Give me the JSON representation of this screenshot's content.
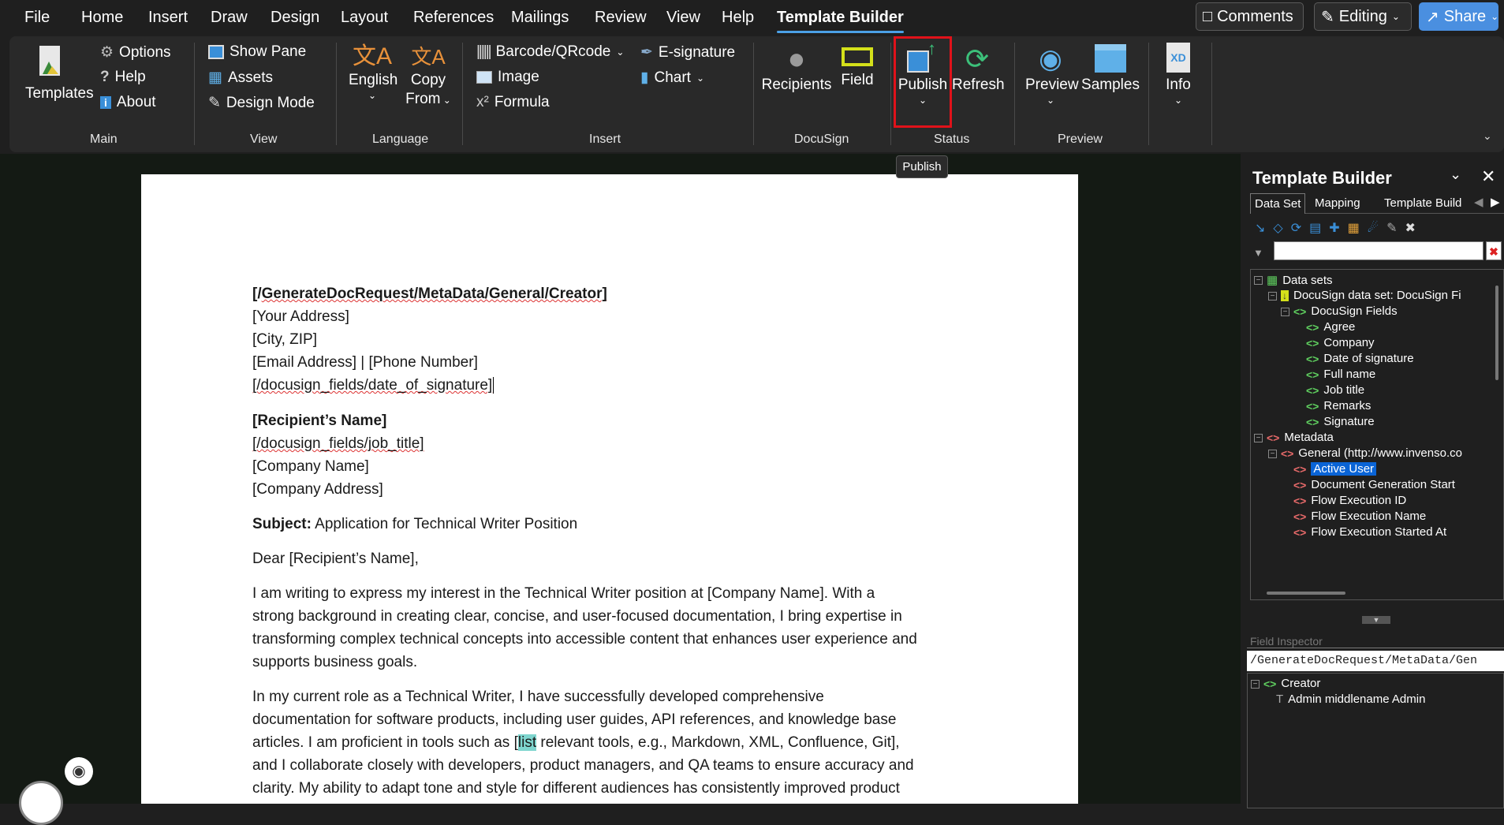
{
  "menu": {
    "tabs": [
      "File",
      "Home",
      "Insert",
      "Draw",
      "Design",
      "Layout",
      "References",
      "Mailings",
      "Review",
      "View",
      "Help",
      "Template Builder"
    ],
    "active": "Template Builder",
    "comments": "Comments",
    "editing": "Editing",
    "share": "Share"
  },
  "ribbon": {
    "main": {
      "templates": "Templates",
      "options": "Options",
      "help": "Help",
      "about": "About",
      "label": "Main"
    },
    "view": {
      "show_pane": "Show Pane",
      "assets": "Assets",
      "design_mode": "Design Mode",
      "label": "View"
    },
    "language": {
      "english": "English",
      "copy": "Copy",
      "from": "From",
      "label": "Language"
    },
    "insert": {
      "barcode": "Barcode/QRcode",
      "image": "Image",
      "formula": "Formula",
      "esign": "E-signature",
      "chart": "Chart",
      "label": "Insert"
    },
    "docusign": {
      "recipients": "Recipients",
      "field": "Field",
      "label": "DocuSign"
    },
    "status": {
      "publish": "Publish",
      "refresh": "Refresh",
      "label": "Status"
    },
    "preview": {
      "preview": "Preview",
      "samples": "Samples",
      "label": "Preview"
    },
    "info": {
      "info": "Info"
    },
    "tooltip": "Publish"
  },
  "doc": {
    "creator": "[/GenerateDocRequest/MetaData/General/Creator]",
    "address": "[Your Address]",
    "city": "[City, ZIP]",
    "email": "[Email Address] | [Phone Number]",
    "date_field": "[/docusign_fields/date_of_signature]",
    "recipient": "[Recipient’s Name]",
    "job_field": "[/docusign_fields/job_title]",
    "company": "[Company Name]",
    "company_addr": "[Company Address]",
    "subject_label": "Subject:",
    "subject": " Application for Technical Writer Position",
    "dear": "Dear [Recipient’s Name],",
    "p1": [
      "I am writing to express my interest in the Technical Writer position at [Company Name]. With a",
      "strong background in creating clear, concise, and user-focused documentation, I bring expertise in",
      "transforming complex technical concepts into accessible content that enhances user experience and",
      "supports business goals."
    ],
    "p2a": "In my current role as a Technical Writer, I have successfully developed comprehensive",
    "p2b": "documentation for software products, including user guides, API references, and knowledge base",
    "p2c_pre": "articles. I am proficient in tools such as [",
    "p2c_hl": "list",
    "p2c_post": " relevant tools, e.g., Markdown, XML, Confluence, Git],",
    "p2d": "and I collaborate closely with developers, product managers, and QA teams to ensure accuracy and",
    "p2e": "clarity. My ability to adapt tone and style for different audiences has consistently improved product"
  },
  "pane": {
    "title": "Template Builder",
    "tabs": [
      "Data Set",
      "Mapping",
      "Template Build"
    ],
    "filter_placeholder": "",
    "tree": [
      {
        "label": "Data sets",
        "level": 0,
        "icon": "datasets-icon"
      },
      {
        "label": "DocuSign data set: DocuSign Fi",
        "level": 1,
        "icon": "download-icon"
      },
      {
        "label": "DocuSign Fields",
        "level": 2,
        "icon": "node"
      },
      {
        "label": "Agree",
        "level": 3,
        "icon": "node"
      },
      {
        "label": "Company",
        "level": 3,
        "icon": "node"
      },
      {
        "label": "Date of signature",
        "level": 3,
        "icon": "node"
      },
      {
        "label": "Full name",
        "level": 3,
        "icon": "node"
      },
      {
        "label": "Job title",
        "level": 3,
        "icon": "node"
      },
      {
        "label": "Remarks",
        "level": 3,
        "icon": "node"
      },
      {
        "label": "Signature",
        "level": 3,
        "icon": "node"
      },
      {
        "label": "Metadata",
        "level": 0,
        "icon": "nodered"
      },
      {
        "label": "General (http://www.invenso.co",
        "level": 1,
        "icon": "nodered"
      },
      {
        "label": "Active User",
        "level": 2,
        "icon": "nodered",
        "selected": true
      },
      {
        "label": "Document Generation Start",
        "level": 2,
        "icon": "nodered"
      },
      {
        "label": "Flow Execution ID",
        "level": 2,
        "icon": "nodered"
      },
      {
        "label": "Flow Execution Name",
        "level": 2,
        "icon": "nodered"
      },
      {
        "label": "Flow Execution Started At",
        "level": 2,
        "icon": "nodered"
      }
    ],
    "inspector_label": "Field Inspector",
    "inspector_path": "/GenerateDocRequest/MetaData/Gen",
    "inspector_node": "Creator",
    "inspector_value": "Admin middlename Admin"
  }
}
